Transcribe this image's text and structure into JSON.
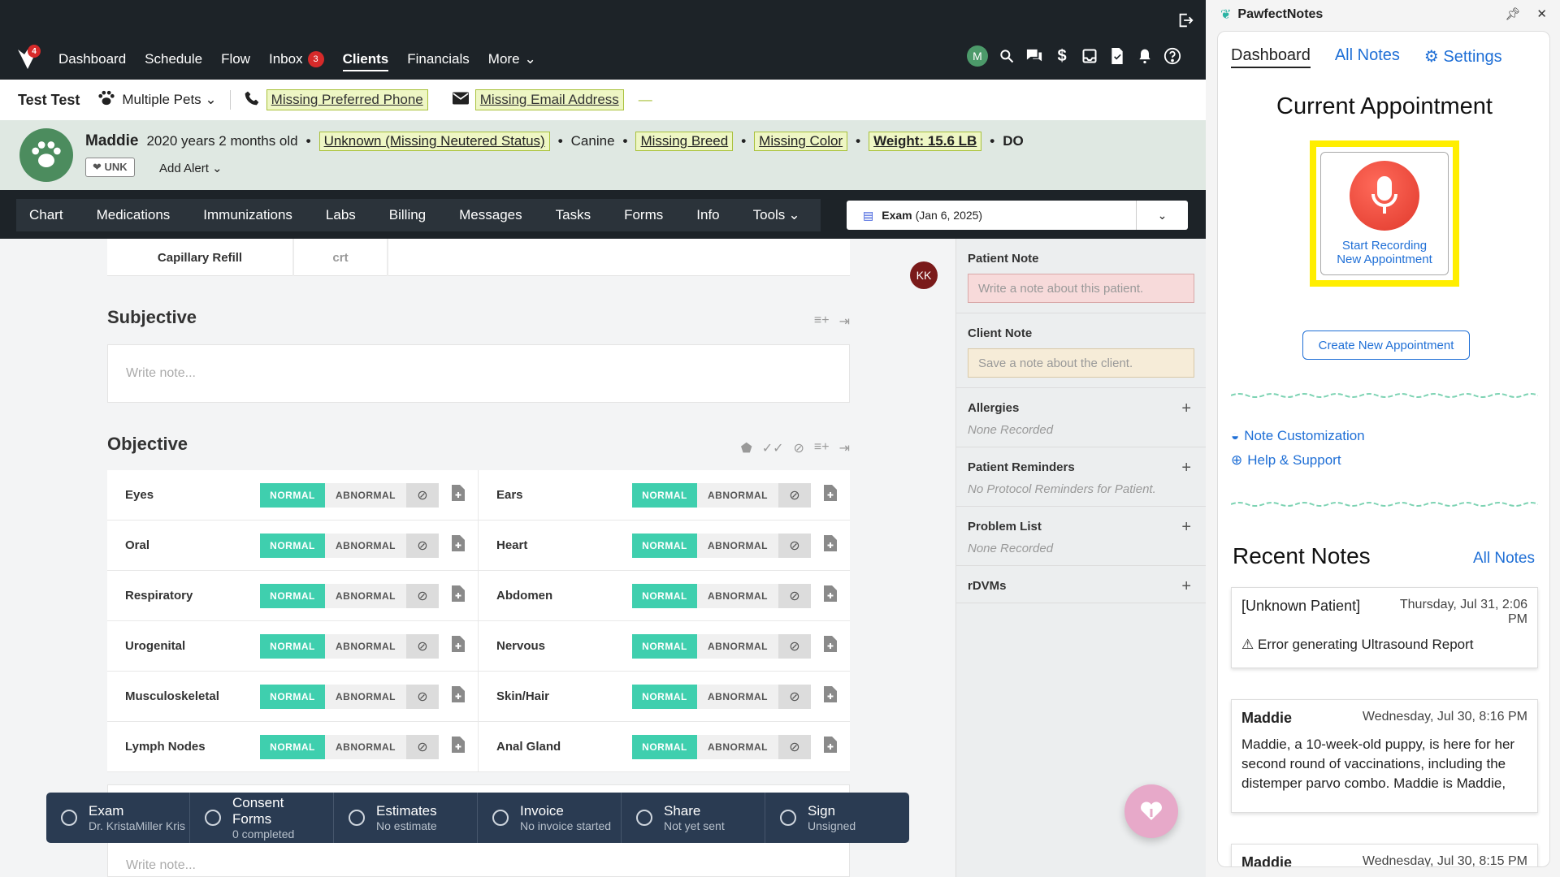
{
  "nav": {
    "logo_badge": "4",
    "items": [
      {
        "label": "Dashboard"
      },
      {
        "label": "Schedule"
      },
      {
        "label": "Flow"
      },
      {
        "label": "Inbox",
        "badge": "3"
      },
      {
        "label": "Clients"
      },
      {
        "label": "Financials"
      },
      {
        "label": "More"
      }
    ],
    "user_initial": "M"
  },
  "client": {
    "name": "Test Test",
    "pets_label": "Multiple Pets",
    "phone_label": "Missing Preferred Phone",
    "email_label": "Missing Email Address"
  },
  "patient": {
    "name": "Maddie",
    "age": "2020 years 2 months old",
    "neuter": "Unknown (Missing Neutered Status)",
    "species": "Canine",
    "breed": "Missing Breed",
    "color": "Missing Color",
    "weight": "Weight: 15.6 LB",
    "doctor": "DO",
    "unk_badge": "UNK",
    "add_alert": "Add Alert"
  },
  "tabs": [
    "Chart",
    "Medications",
    "Immunizations",
    "Labs",
    "Billing",
    "Messages",
    "Tasks",
    "Forms",
    "Info",
    "Tools"
  ],
  "exam_select": {
    "label": "Exam",
    "date": "(Jan 6, 2025)"
  },
  "crt": {
    "label": "Capillary Refill",
    "value": "crt"
  },
  "subjective": {
    "title": "Subjective",
    "placeholder": "Write note..."
  },
  "objective": {
    "title": "Objective",
    "normal": "NORMAL",
    "abnormal": "ABNORMAL",
    "rows": [
      [
        "Eyes",
        "Ears"
      ],
      [
        "Oral",
        "Heart"
      ],
      [
        "Respiratory",
        "Abdomen"
      ],
      [
        "Urogenital",
        "Nervous"
      ],
      [
        "Musculoskeletal",
        "Skin/Hair"
      ],
      [
        "Lymph Nodes",
        "Anal Gland"
      ]
    ],
    "bottom_placeholder": "Write note..."
  },
  "kk": "KK",
  "statusbar": [
    {
      "t1": "Exam",
      "t2": "Dr. KristaMiller Kris"
    },
    {
      "t1": "Consent Forms",
      "t2": "0 completed"
    },
    {
      "t1": "Estimates",
      "t2": "No estimate"
    },
    {
      "t1": "Invoice",
      "t2": "No invoice started"
    },
    {
      "t1": "Share",
      "t2": "Not yet sent"
    },
    {
      "t1": "Sign",
      "t2": "Unsigned"
    }
  ],
  "rightcol": {
    "patient_note": {
      "title": "Patient Note",
      "placeholder": "Write a note about this patient."
    },
    "client_note": {
      "title": "Client Note",
      "placeholder": "Save a note about the client."
    },
    "allergies": {
      "title": "Allergies",
      "value": "None Recorded"
    },
    "reminders": {
      "title": "Patient Reminders",
      "value": "No Protocol Reminders for Patient."
    },
    "problems": {
      "title": "Problem List",
      "value": "None Recorded"
    },
    "rdvms": {
      "title": "rDVMs"
    }
  },
  "panel": {
    "title": "PawfectNotes",
    "tabs": [
      "Dashboard",
      "All Notes",
      "Settings"
    ],
    "current_title": "Current Appointment",
    "record_l1": "Start Recording",
    "record_l2": "New Appointment",
    "create_btn": "Create New Appointment",
    "link_customization": "Note Customization",
    "link_help": "Help & Support",
    "recent_title": "Recent Notes",
    "recent_all": "All Notes",
    "notes": [
      {
        "patient": "[Unknown Patient]",
        "date": "Thursday, Jul 31, 2:06 PM",
        "body": "Error generating Ultrasound Report"
      },
      {
        "patient": "Maddie",
        "date": "Wednesday, Jul 30, 8:16 PM",
        "body": "Maddie, a 10-week-old puppy, is here for her second round of vaccinations, including the distemper parvo combo. Maddie is Maddie,"
      },
      {
        "patient": "Maddie",
        "date": "Wednesday, Jul 30, 8:15 PM",
        "body": ""
      }
    ]
  },
  "colors": {
    "accent_green": "#3fcfae",
    "nav_dark": "#1d2328",
    "link_blue": "#1f6fd6",
    "highlight_yellow": "#ffee00",
    "mic_red": "#e0392c"
  }
}
